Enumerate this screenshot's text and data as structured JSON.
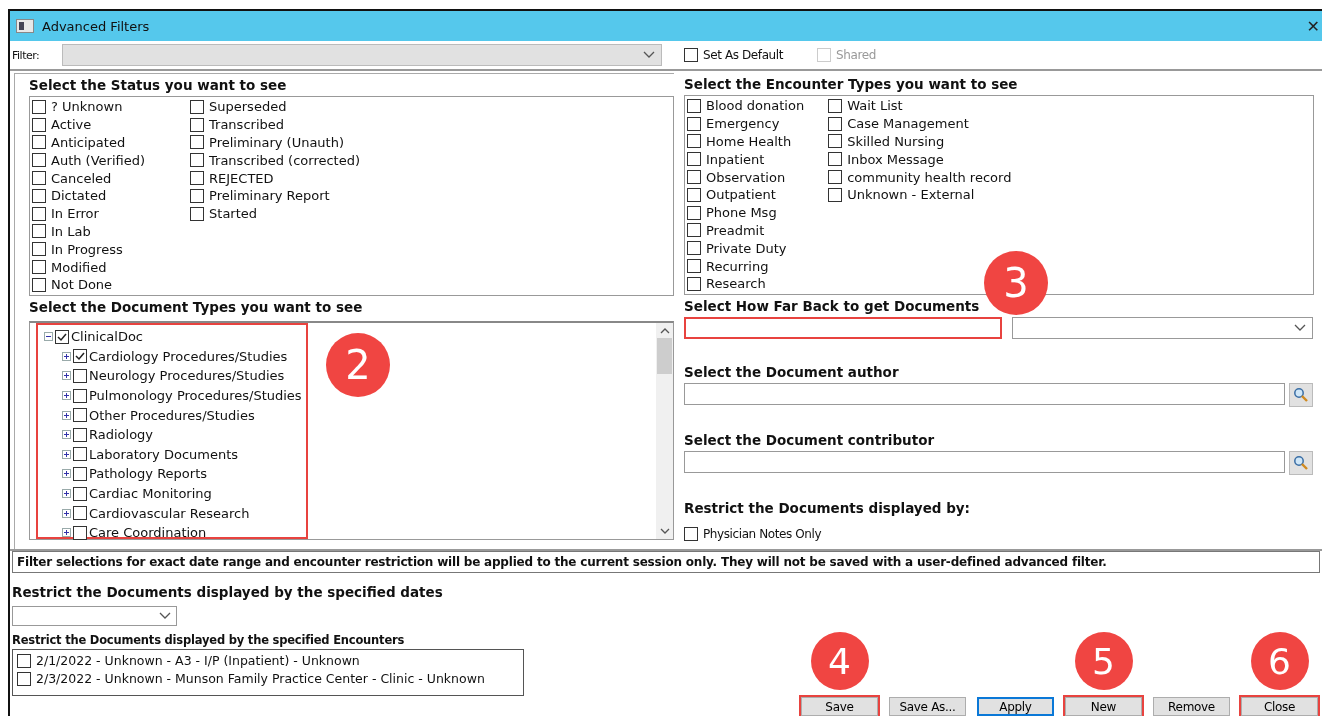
{
  "window": {
    "title": "Advanced Filters",
    "close": "✕"
  },
  "filter": {
    "label": "Filter:",
    "set_as_default": {
      "label": "Set As Default",
      "checked": false,
      "disabled": false
    },
    "shared": {
      "label": "Shared",
      "checked": false,
      "disabled": true
    }
  },
  "status": {
    "title": "Select the Status you want to see",
    "items": [
      {
        "label": "? Unknown",
        "checked": false
      },
      {
        "label": "Active",
        "checked": false
      },
      {
        "label": "Anticipated",
        "checked": false
      },
      {
        "label": "Auth (Verified)",
        "checked": false
      },
      {
        "label": "Canceled",
        "checked": false
      },
      {
        "label": "Dictated",
        "checked": false
      },
      {
        "label": "In Error",
        "checked": false
      },
      {
        "label": "In Lab",
        "checked": false
      },
      {
        "label": "In Progress",
        "checked": false
      },
      {
        "label": "Modified",
        "checked": false
      },
      {
        "label": "Not Done",
        "checked": false
      },
      {
        "label": "Superseded",
        "checked": false
      },
      {
        "label": "Transcribed",
        "checked": false
      },
      {
        "label": "Preliminary (Unauth)",
        "checked": false
      },
      {
        "label": "Transcribed (corrected)",
        "checked": false
      },
      {
        "label": "REJECTED",
        "checked": false
      },
      {
        "label": "Preliminary Report",
        "checked": false
      },
      {
        "label": "Started",
        "checked": false
      }
    ]
  },
  "encounter_types": {
    "title": "Select the Encounter Types you want to see",
    "items": [
      {
        "label": "Blood donation",
        "checked": false
      },
      {
        "label": "Emergency",
        "checked": false
      },
      {
        "label": "Home Health",
        "checked": false
      },
      {
        "label": "Inpatient",
        "checked": false
      },
      {
        "label": "Observation",
        "checked": false
      },
      {
        "label": "Outpatient",
        "checked": false
      },
      {
        "label": "Phone Msg",
        "checked": false
      },
      {
        "label": "Preadmit",
        "checked": false
      },
      {
        "label": "Private Duty",
        "checked": false
      },
      {
        "label": "Recurring",
        "checked": false
      },
      {
        "label": "Research",
        "checked": false
      },
      {
        "label": "Wait List",
        "checked": false
      },
      {
        "label": "Case Management",
        "checked": false
      },
      {
        "label": "Skilled Nursing",
        "checked": false
      },
      {
        "label": "Inbox Message",
        "checked": false
      },
      {
        "label": "community health record",
        "checked": false
      },
      {
        "label": "Unknown - External",
        "checked": false
      }
    ]
  },
  "document_types": {
    "title": "Select the Document Types you want to see",
    "highlighted": true,
    "callout": "2",
    "tree": [
      {
        "label": "ClinicalDoc",
        "checked": true,
        "expanded": true,
        "children": [
          {
            "label": "Cardiology Procedures/Studies",
            "checked": true,
            "expanded": false
          },
          {
            "label": "Neurology Procedures/Studies",
            "checked": false,
            "expanded": false
          },
          {
            "label": "Pulmonology Procedures/Studies",
            "checked": false,
            "expanded": false
          },
          {
            "label": "Other Procedures/Studies",
            "checked": false,
            "expanded": false
          },
          {
            "label": "Radiology",
            "checked": false,
            "expanded": false
          },
          {
            "label": "Laboratory Documents",
            "checked": false,
            "expanded": false
          },
          {
            "label": "Pathology Reports",
            "checked": false,
            "expanded": false
          },
          {
            "label": "Cardiac Monitoring",
            "checked": false,
            "expanded": false
          },
          {
            "label": "Cardiovascular Research",
            "checked": false,
            "expanded": false
          },
          {
            "label": "Care Coordination",
            "checked": false,
            "expanded": false
          }
        ]
      }
    ]
  },
  "how_far_back": {
    "title": "Select How Far Back to get Documents",
    "highlighted": true,
    "callout": "3"
  },
  "author": {
    "title": "Select the Document author"
  },
  "contributor": {
    "title": "Select the Document contributor"
  },
  "restrict": {
    "title": "Restrict the Documents displayed by:",
    "physician_notes": {
      "label": "Physician Notes Only",
      "checked": false
    }
  },
  "notice": "Filter selections for exact date range and encounter restriction will be applied to the current session only.  They will not be saved with a user-defined advanced filter.",
  "dates": {
    "title": "Restrict the Documents displayed by the specified dates"
  },
  "encounters": {
    "title": "Restrict the Documents displayed by the specified Encounters",
    "items": [
      {
        "label": "2/1/2022 - Unknown - A3 - I/P (Inpatient) - Unknown",
        "checked": false
      },
      {
        "label": "2/3/2022 - Unknown - Munson Family Practice Center - Clinic - Unknown",
        "checked": false
      }
    ]
  },
  "buttons": [
    {
      "label": "Save",
      "focused": false,
      "highlighted": true,
      "callout": "4"
    },
    {
      "label": "Save As...",
      "focused": false,
      "highlighted": false
    },
    {
      "label": "Apply",
      "focused": true,
      "highlighted": false
    },
    {
      "label": "New",
      "focused": false,
      "highlighted": true,
      "callout": "5"
    },
    {
      "label": "Remove",
      "focused": false,
      "highlighted": false
    },
    {
      "label": "Close",
      "focused": false,
      "highlighted": true,
      "callout": "6"
    }
  ]
}
